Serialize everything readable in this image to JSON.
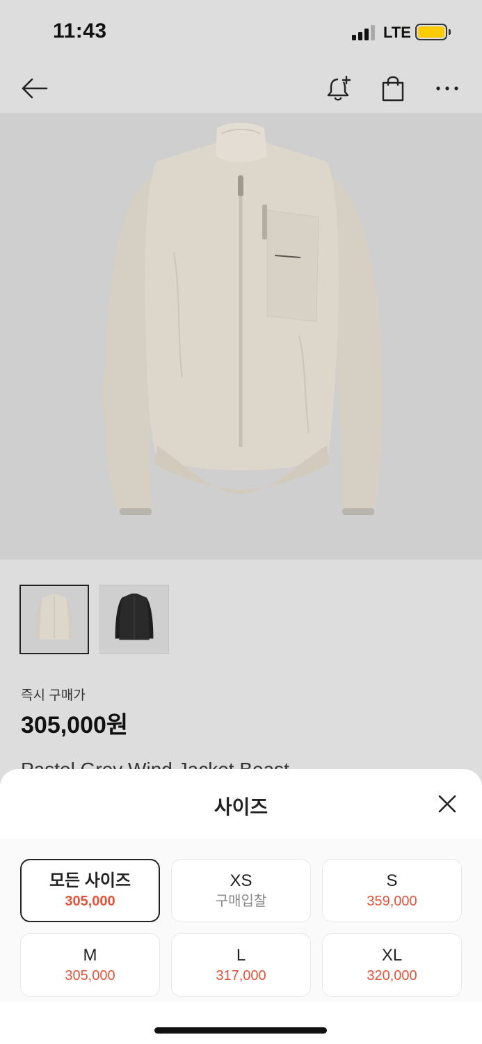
{
  "status_bar": {
    "time": "11:43",
    "network": "LTE",
    "battery_color": "#ffcc00"
  },
  "nav": {
    "back_icon": "arrow-left-icon",
    "alert_icon": "bell-plus-icon",
    "cart_icon": "shopping-bag-icon",
    "more_icon": "more-horizontal-icon"
  },
  "product": {
    "price_label": "즉시 구매가",
    "price": "305,000원",
    "name": "Pastel Grey Wind Jacket Beast"
  },
  "thumbnails": [
    {
      "color": "beige",
      "selected": true
    },
    {
      "color": "black",
      "selected": false
    }
  ],
  "size_sheet": {
    "title": "사이즈",
    "close_icon": "close-icon",
    "options": [
      {
        "size": "모든 사이즈",
        "price": "305,000",
        "selected": true
      },
      {
        "size": "XS",
        "price": "구매입찰",
        "selected": false
      },
      {
        "size": "S",
        "price": "359,000",
        "selected": false
      },
      {
        "size": "M",
        "price": "305,000",
        "selected": false
      },
      {
        "size": "L",
        "price": "317,000",
        "selected": false
      },
      {
        "size": "XL",
        "price": "320,000",
        "selected": false
      }
    ]
  },
  "colors": {
    "price_accent": "#e2533a",
    "muted_text": "#888888"
  }
}
